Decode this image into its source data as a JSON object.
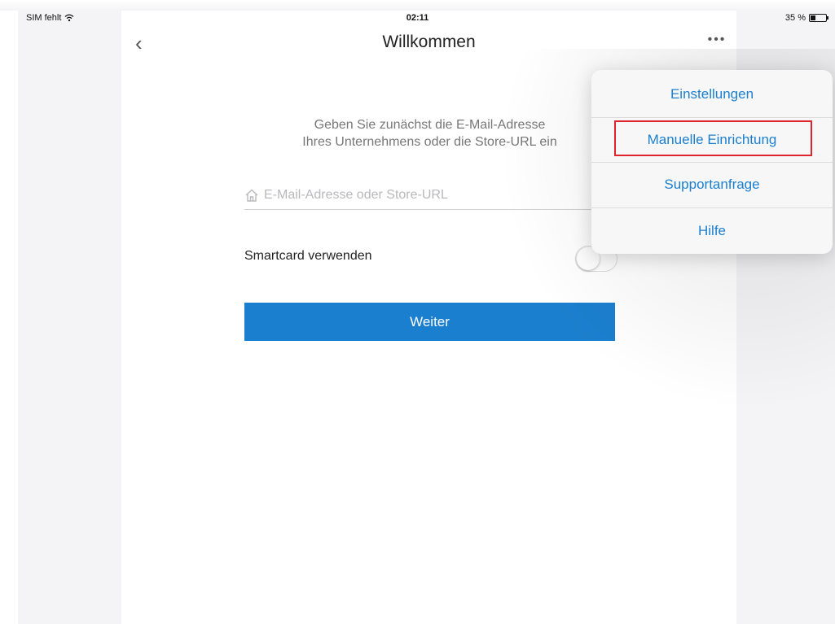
{
  "status_bar": {
    "carrier": "SIM fehlt",
    "time": "02:11",
    "battery_text": "35 %",
    "battery_level": 0.35
  },
  "nav": {
    "back_glyph": "‹",
    "title": "Willkommen",
    "more_glyph": "•••"
  },
  "form": {
    "instruction_line1": "Geben Sie zunächst die E-Mail-Adresse",
    "instruction_line2": "Ihres Unternehmens oder die Store-URL ein",
    "email_placeholder": "E-Mail-Adresse oder Store-URL",
    "email_value": "",
    "smartcard_label": "Smartcard verwenden",
    "smartcard_enabled": false,
    "continue_label": "Weiter"
  },
  "menu": {
    "items": [
      {
        "label": "Einstellungen"
      },
      {
        "label": "Manuelle Einrichtung",
        "highlighted": true
      },
      {
        "label": "Supportanfrage"
      },
      {
        "label": "Hilfe"
      }
    ]
  },
  "colors": {
    "accent": "#1b7fcf",
    "highlight": "#e0242e",
    "sidebar_bg": "#f4f4f6"
  },
  "icons": {
    "wifi": "wifi-icon",
    "battery": "battery-icon",
    "back": "chevron-left-icon",
    "more": "more-icon",
    "home": "home-icon"
  }
}
